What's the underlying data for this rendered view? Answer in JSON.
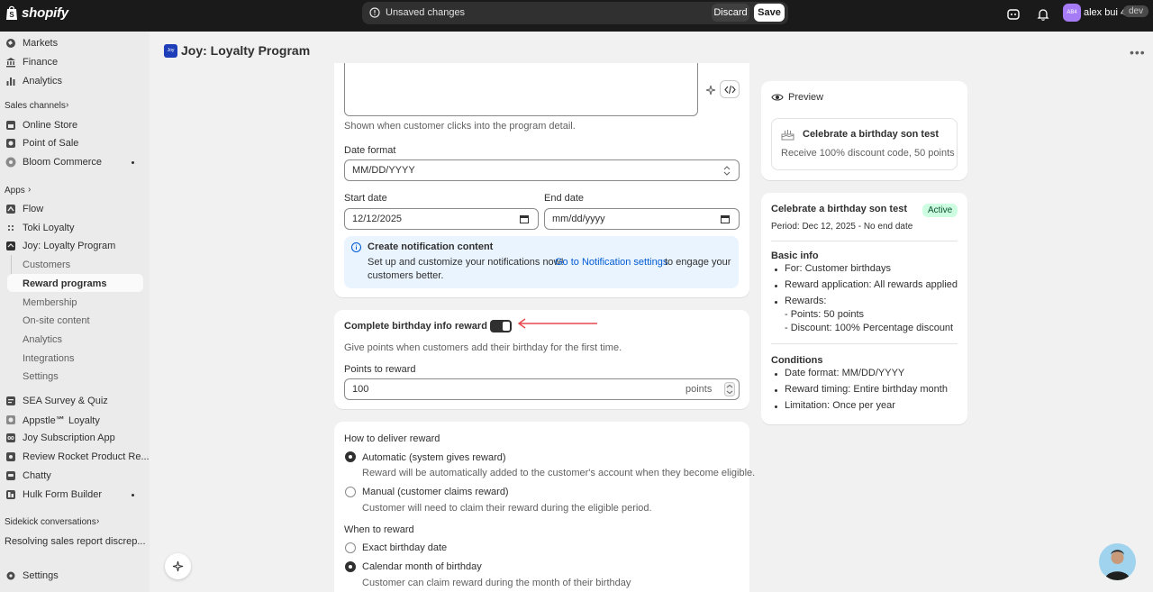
{
  "topbar": {
    "logo_text": "shopify",
    "unsaved_text": "Unsaved changes",
    "discard_label": "Discard",
    "save_label": "Save",
    "user_initials": "AB4",
    "user_name": "alex bui 4",
    "store_badge": "dev"
  },
  "sidebar": {
    "items_top": [
      {
        "label": "Markets",
        "icon": "globe-icon"
      },
      {
        "label": "Finance",
        "icon": "bank-icon"
      },
      {
        "label": "Analytics",
        "icon": "chart-icon"
      }
    ],
    "sales_channels_header": "Sales channels",
    "sales_channels": [
      {
        "label": "Online Store"
      },
      {
        "label": "Point of Sale"
      },
      {
        "label": "Bloom Commerce"
      }
    ],
    "apps_header": "Apps",
    "apps": [
      {
        "label": "Flow"
      },
      {
        "label": "Toki Loyalty"
      },
      {
        "label": "Joy: Loyalty Program"
      }
    ],
    "joy_sub": [
      "Customers",
      "Reward programs",
      "Membership",
      "On-site content",
      "Analytics",
      "Integrations",
      "Settings"
    ],
    "apps_more": [
      {
        "label": "SEA Survey & Quiz"
      },
      {
        "label": "Appstle℠ Loyalty"
      },
      {
        "label": "Joy Subscription App"
      },
      {
        "label": "Review Rocket Product Re..."
      },
      {
        "label": "Chatty"
      },
      {
        "label": "Hulk Form Builder"
      }
    ],
    "sidekick_header": "Sidekick conversations",
    "sidekick_item": "Resolving sales report discrep...",
    "settings_label": "Settings"
  },
  "page": {
    "app_badge": "Joy",
    "title": "Joy: Loyalty Program"
  },
  "form": {
    "description_help": "Shown when customer clicks into the program detail.",
    "date_format_label": "Date format",
    "date_format_value": "MM/DD/YYYY",
    "start_date_label": "Start date",
    "start_date_value": "12/12/2025",
    "end_date_label": "End date",
    "end_date_value": "mm/dd/yyyy",
    "banner_title": "Create notification content",
    "banner_text_1": "Set up and customize your notifications now!",
    "banner_link": "Go to Notification settings",
    "banner_text_2": "to engage your",
    "banner_text_3": "customers better.",
    "birthday_info_title": "Complete birthday info reward",
    "birthday_info_desc": "Give points when customers add their birthday for the first time.",
    "points_label": "Points to reward",
    "points_value": "100",
    "points_suffix": "points",
    "deliver_label": "How to deliver reward",
    "deliver_auto": "Automatic (system gives reward)",
    "deliver_auto_desc": "Reward will be automatically added to the customer's account when they become eligible.",
    "deliver_manual": "Manual (customer claims reward)",
    "deliver_manual_desc": "Customer will need to claim their reward during the eligible period.",
    "when_label": "When to reward",
    "when_exact": "Exact birthday date",
    "when_month": "Calendar month of birthday",
    "when_month_desc": "Customer can claim reward during the month of their birthday"
  },
  "preview": {
    "header": "Preview",
    "card_title": "Celebrate a birthday son test",
    "card_sub": "Receive 100% discount code, 50 points"
  },
  "summary": {
    "title": "Celebrate a birthday son test",
    "status": "Active",
    "period": "Period: Dec 12, 2025 - No end date",
    "basic_header": "Basic info",
    "basic_for": "For: Customer birthdays",
    "basic_application": "Reward application: All rewards applied",
    "basic_rewards": "Rewards:",
    "reward_points": "- Points: 50 points",
    "reward_discount": "- Discount: 100% Percentage discount",
    "conditions_header": "Conditions",
    "cond_date_format": "Date format: MM/DD/YYYY",
    "cond_timing": "Reward timing: Entire birthday month",
    "cond_limitation": "Limitation: Once per year"
  },
  "colors": {
    "topbar_bg": "#1a1a1a",
    "link": "#005bd3",
    "active_badge_bg": "#cdfee1",
    "annotation_arrow": "#e5484d",
    "app_badge_bg": "#1d3eb8"
  }
}
